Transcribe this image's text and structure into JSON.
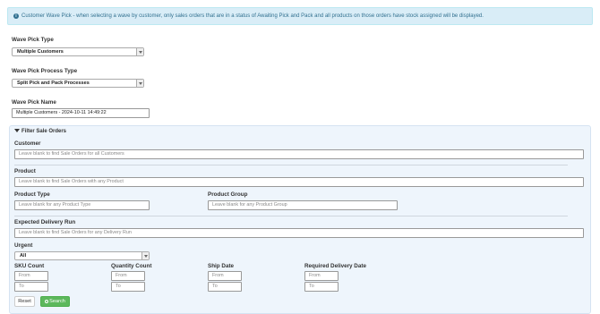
{
  "alert": {
    "icon": "info-icon",
    "text": "Customer Wave Pick - when selecting a wave by customer, only sales orders that are in a status of Awaiting Pick and Pack and all products on those orders have stock assigned will be displayed."
  },
  "wave_pick_type": {
    "label": "Wave Pick Type",
    "value": "Multiple Customers"
  },
  "wave_pick_process_type": {
    "label": "Wave Pick Process Type",
    "value": "Split Pick and Pack Processes"
  },
  "wave_pick_name": {
    "label": "Wave Pick Name",
    "value": "Multiple Customers - 2024-10-11 14:49:22"
  },
  "filter": {
    "title": "Filter Sale Orders",
    "customer": {
      "label": "Customer",
      "placeholder": "Leave blank to find Sale Orders for all Customers"
    },
    "product": {
      "label": "Product",
      "placeholder": "Leave blank to find Sale Orders with any Product"
    },
    "product_type": {
      "label": "Product Type",
      "placeholder": "Leave blank for any Product Type"
    },
    "product_group": {
      "label": "Product Group",
      "placeholder": "Leave blank for any Product Group"
    },
    "delivery_run": {
      "label": "Expected Delivery Run",
      "placeholder": "Leave blank to find Sale Orders for any Delivery Run"
    },
    "urgent": {
      "label": "Urgent",
      "value": "All"
    },
    "sku_count": {
      "label": "SKU Count",
      "from": "From",
      "to": "To"
    },
    "quantity_count": {
      "label": "Quantity Count",
      "from": "From",
      "to": "To"
    },
    "ship_date": {
      "label": "Ship Date",
      "from": "From",
      "to": "To"
    },
    "required_delivery_date": {
      "label": "Required Delivery Date",
      "from": "From",
      "to": "To"
    }
  },
  "buttons": {
    "reset": "Reset",
    "search": "Search"
  }
}
